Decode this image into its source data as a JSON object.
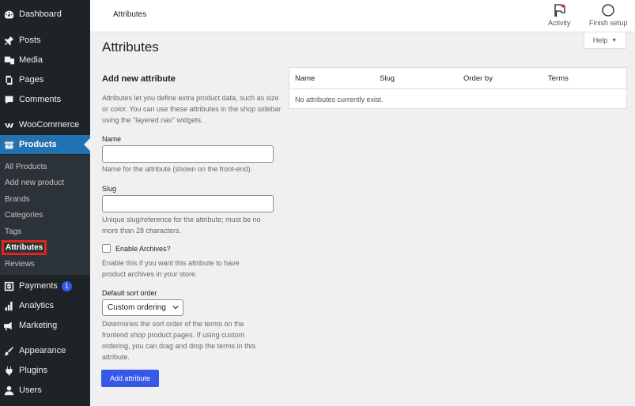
{
  "sidebar": {
    "menu": [
      {
        "label": "Dashboard",
        "icon": "dashboard-icon"
      },
      {
        "label": "Posts",
        "icon": "pin-icon"
      },
      {
        "label": "Media",
        "icon": "media-icon"
      },
      {
        "label": "Pages",
        "icon": "pages-icon"
      },
      {
        "label": "Comments",
        "icon": "comments-icon"
      },
      {
        "label": "WooCommerce",
        "icon": "woo-icon"
      },
      {
        "label": "Products",
        "icon": "products-icon"
      },
      {
        "label": "Payments",
        "icon": "payments-icon",
        "badge": "1"
      },
      {
        "label": "Analytics",
        "icon": "analytics-icon"
      },
      {
        "label": "Marketing",
        "icon": "megaphone-icon"
      },
      {
        "label": "Appearance",
        "icon": "brush-icon"
      },
      {
        "label": "Plugins",
        "icon": "plugin-icon"
      },
      {
        "label": "Users",
        "icon": "users-icon"
      }
    ],
    "submenu": [
      "All Products",
      "Add new product",
      "Brands",
      "Categories",
      "Tags",
      "Attributes",
      "Reviews"
    ]
  },
  "header": {
    "title": "Attributes",
    "activity_label": "Activity",
    "finish_setup_label": "Finish setup"
  },
  "help_label": "Help",
  "page_title": "Attributes",
  "form": {
    "heading": "Add new attribute",
    "intro": "Attributes let you define extra product data, such as size or color. You can use these attributes in the shop sidebar using the \"layered nav\" widgets.",
    "name_label": "Name",
    "name_value": "",
    "name_help": "Name for the attribute (shown on the front-end).",
    "slug_label": "Slug",
    "slug_value": "",
    "slug_help": "Unique slug/reference for the attribute; must be no more than 28 characters.",
    "archives_label": "Enable Archives?",
    "archives_help": "Enable this if you want this attribute to have product archives in your store.",
    "sort_label": "Default sort order",
    "sort_value": "Custom ordering",
    "sort_help": "Determines the sort order of the terms on the frontend shop product pages. If using custom ordering, you can drag and drop the terms in this attribute.",
    "submit_label": "Add attribute"
  },
  "table": {
    "columns": [
      "Name",
      "Slug",
      "Order by",
      "Terms"
    ],
    "empty_message": "No attributes currently exist."
  },
  "colors": {
    "sidebar_bg": "#1d2327",
    "active_bg": "#2271b1",
    "primary_button": "#3858e9",
    "highlight_outline": "#e0261b"
  }
}
